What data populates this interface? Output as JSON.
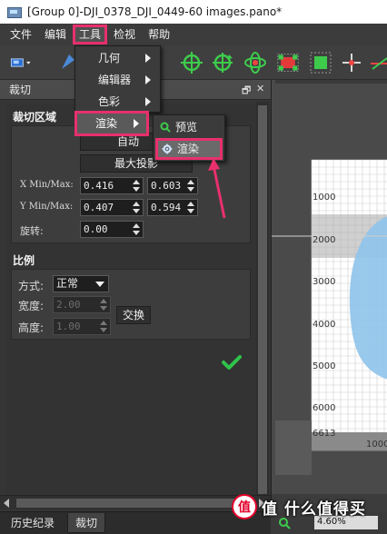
{
  "window": {
    "title": "[Group 0]-DJI_0378_DJI_0449-60 images.pano*"
  },
  "menubar": {
    "items": [
      "文件",
      "编辑",
      "工具",
      "检视",
      "帮助"
    ]
  },
  "tools_menu": {
    "items": [
      "几何",
      "编辑器",
      "色彩",
      "渲染"
    ]
  },
  "render_submenu": {
    "items": [
      "预览",
      "渲染"
    ]
  },
  "panel": {
    "title": "裁切",
    "pin_glyph": "🗗",
    "close_glyph": "✕",
    "crop_section": {
      "title": "裁切区域",
      "auto_button": "自动",
      "max_projection_button": "最大投影",
      "x_label": "X Min/Max:",
      "x_min": "0.416",
      "x_max": "0.603",
      "y_label": "Y Min/Max:",
      "y_min": "0.407",
      "y_max": "0.594",
      "rotate_label": "旋转:",
      "rotate_value": "0.00"
    },
    "ratio_section": {
      "title": "比例",
      "mode_label": "方式:",
      "mode_value": "正常",
      "width_label": "宽度:",
      "width_value": "2.00",
      "height_label": "高度:",
      "height_value": "1.00",
      "swap_button": "交换"
    }
  },
  "canvas": {
    "ruler_labels": [
      "1000",
      "2000",
      "3000",
      "4000",
      "5000",
      "6000",
      "6613"
    ],
    "bottom_label": "1000"
  },
  "bottom_tabs": [
    "历史纪录",
    "裁切"
  ],
  "status": {
    "zoom": "4.60%"
  },
  "watermark": {
    "text": "值 什么值得买",
    "glyph": "值"
  },
  "colors": {
    "highlight": "#e8306c",
    "check": "#2fc34a",
    "panorama": "#8ec3ea"
  }
}
